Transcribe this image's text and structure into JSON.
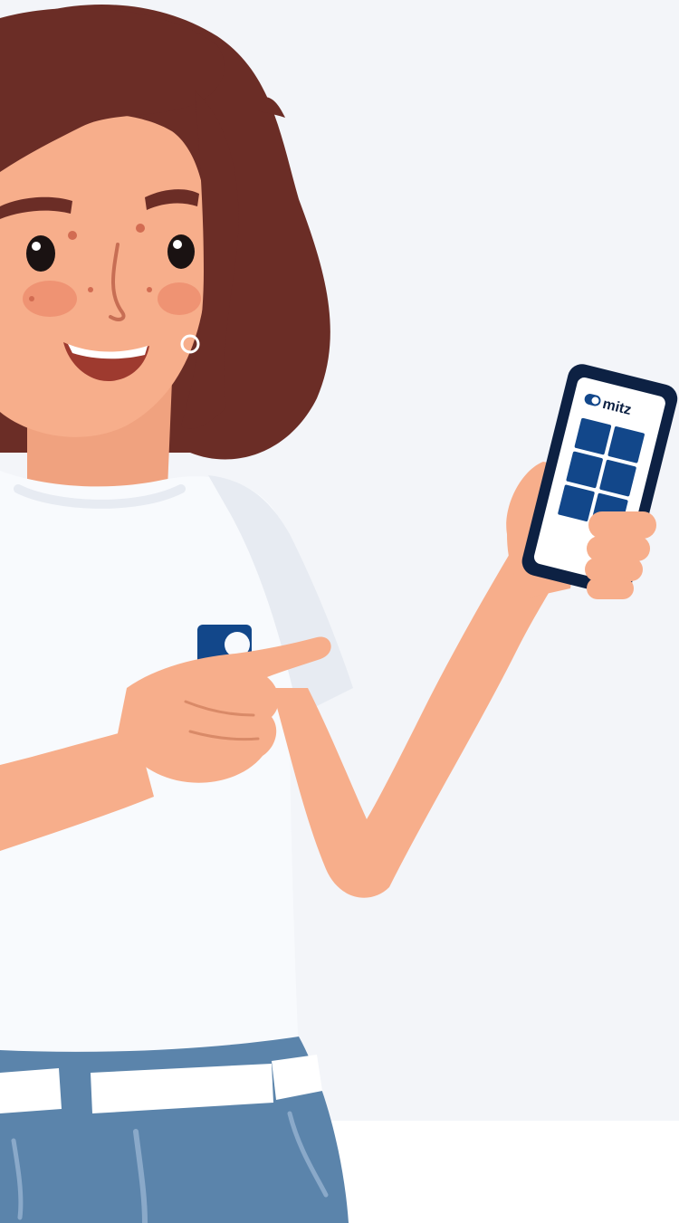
{
  "illustration": {
    "subject": "woman-pointing-at-phone",
    "phone_app_logo_text": "mitz",
    "colors": {
      "background_panel": "#f3f5f9",
      "bottom_area": "#ffffff",
      "hair": "#6b2d26",
      "skin": "#f7ae8b",
      "cheek": "#ec8a6b",
      "shirt": "#f8fafd",
      "shirt_shadow": "#e7ebf2",
      "jeans": "#5b84ab",
      "jeans_dark": "#4e7499",
      "belt": "#ffffff",
      "brand_blue": "#12478a",
      "phone_frame": "#0d2143",
      "phone_screen": "#ffffff"
    }
  }
}
